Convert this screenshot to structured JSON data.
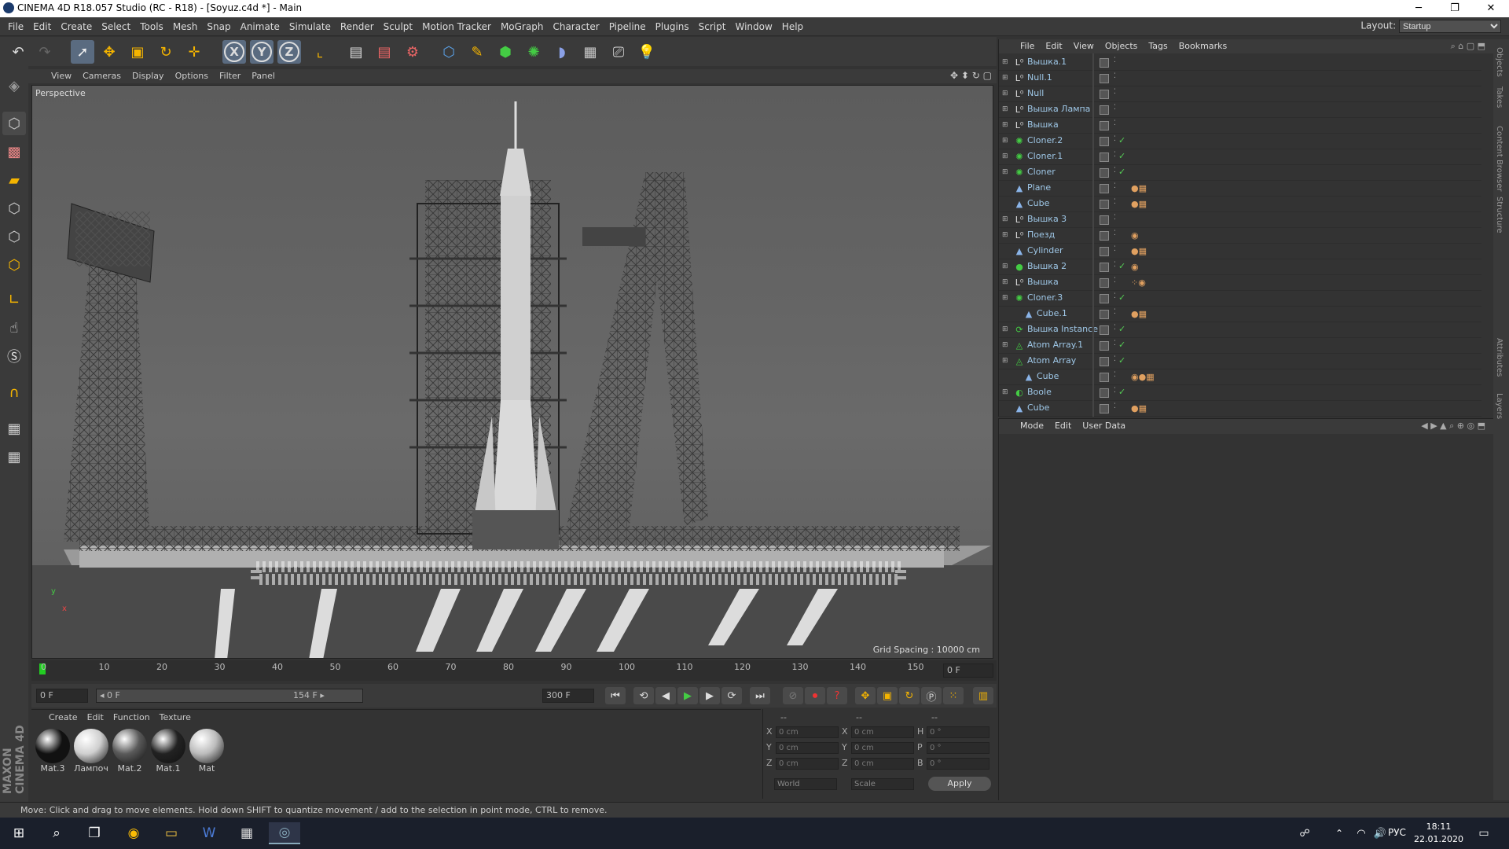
{
  "window": {
    "title": "CINEMA 4D R18.057 Studio (RC - R18) - [Soyuz.c4d *] - Main",
    "minimize": "─",
    "maximize": "❐",
    "close": "✕"
  },
  "menubar": {
    "items": [
      "File",
      "Edit",
      "Create",
      "Select",
      "Tools",
      "Mesh",
      "Snap",
      "Animate",
      "Simulate",
      "Render",
      "Sculpt",
      "Motion Tracker",
      "MoGraph",
      "Character",
      "Pipeline",
      "Plugins",
      "Script",
      "Window",
      "Help"
    ],
    "layout_label": "Layout:",
    "layout_value": "Startup"
  },
  "toolbar": {
    "axis_x": "X",
    "axis_y": "Y",
    "axis_z": "Z"
  },
  "viewport": {
    "menu": [
      "View",
      "Cameras",
      "Display",
      "Options",
      "Filter",
      "Panel"
    ],
    "label": "Perspective",
    "grid_spacing": "Grid Spacing : 10000 cm",
    "axis_y": "y",
    "axis_x": "x"
  },
  "timeline": {
    "ticks": [
      "0",
      "10",
      "20",
      "30",
      "40",
      "50",
      "60",
      "70",
      "80",
      "90",
      "100",
      "110",
      "120",
      "130",
      "140",
      "150"
    ],
    "current_frame": "0 F"
  },
  "transport": {
    "start": "0 F",
    "range_start": "◂ 0 F",
    "range_end": "154 F ▸",
    "end": "300 F"
  },
  "materials": {
    "menu": [
      "Create",
      "Edit",
      "Function",
      "Texture"
    ],
    "items": [
      {
        "name": "Mat.3",
        "color": "#111111"
      },
      {
        "name": "Лампоч",
        "color": "#cfcfcf"
      },
      {
        "name": "Mat.2",
        "color": "#5a5a5a"
      },
      {
        "name": "Mat.1",
        "color": "#222222"
      },
      {
        "name": "Mat",
        "color": "#bcbcbc"
      }
    ]
  },
  "coordinates": {
    "headers": [
      "--",
      "--",
      "--"
    ],
    "rows": [
      {
        "a": "X",
        "av": "0 cm",
        "b": "X",
        "bv": "0 cm",
        "c": "H",
        "cv": "0 °"
      },
      {
        "a": "Y",
        "av": "0 cm",
        "b": "Y",
        "bv": "0 cm",
        "c": "P",
        "cv": "0 °"
      },
      {
        "a": "Z",
        "av": "0 cm",
        "b": "Z",
        "bv": "0 cm",
        "c": "B",
        "cv": "0 °"
      }
    ],
    "world": "World",
    "scale": "Scale",
    "apply": "Apply"
  },
  "object_manager": {
    "menu": [
      "File",
      "Edit",
      "View",
      "Objects",
      "Tags",
      "Bookmarks"
    ],
    "objects": [
      {
        "name": "Вышка.1",
        "type": "null",
        "indent": 0,
        "check": "",
        "tags": ""
      },
      {
        "name": "Null.1",
        "type": "null",
        "indent": 0,
        "check": "",
        "tags": ""
      },
      {
        "name": "Null",
        "type": "null",
        "indent": 0,
        "check": "",
        "tags": ""
      },
      {
        "name": "Вышка Лампа",
        "type": "null",
        "indent": 0,
        "check": "",
        "tags": ""
      },
      {
        "name": "Вышка",
        "type": "null",
        "indent": 0,
        "check": "",
        "tags": ""
      },
      {
        "name": "Cloner.2",
        "type": "cloner",
        "indent": 0,
        "check": "✓",
        "tags": ""
      },
      {
        "name": "Cloner.1",
        "type": "cloner",
        "indent": 0,
        "check": "✓",
        "tags": ""
      },
      {
        "name": "Cloner",
        "type": "cloner",
        "indent": 0,
        "check": "✓",
        "tags": ""
      },
      {
        "name": "Plane",
        "type": "poly",
        "indent": 0,
        "check": "",
        "tags": "●▦"
      },
      {
        "name": "Cube",
        "type": "poly",
        "indent": 0,
        "check": "",
        "tags": "●▦"
      },
      {
        "name": "Вышка 3",
        "type": "null",
        "indent": 0,
        "check": "",
        "tags": ""
      },
      {
        "name": "Поезд",
        "type": "null",
        "indent": 0,
        "check": "",
        "tags": "◉"
      },
      {
        "name": "Cylinder",
        "type": "poly",
        "indent": 0,
        "check": "",
        "tags": "●▦"
      },
      {
        "name": "Вышка 2",
        "type": "sphere",
        "indent": 0,
        "check": "✓",
        "tags": "◉"
      },
      {
        "name": "Вышка",
        "type": "null",
        "indent": 0,
        "check": "",
        "tags": "⁘◉"
      },
      {
        "name": "Cloner.3",
        "type": "cloner",
        "indent": 0,
        "check": "✓",
        "tags": ""
      },
      {
        "name": "Cube.1",
        "type": "poly",
        "indent": 1,
        "check": "",
        "tags": "●▦"
      },
      {
        "name": "Вышка Instance",
        "type": "instance",
        "indent": 0,
        "check": "✓",
        "tags": ""
      },
      {
        "name": "Atom Array.1",
        "type": "atom",
        "indent": 0,
        "check": "✓",
        "tags": ""
      },
      {
        "name": "Atom Array",
        "type": "atom",
        "indent": 0,
        "check": "✓",
        "tags": ""
      },
      {
        "name": "Cube",
        "type": "poly",
        "indent": 1,
        "check": "",
        "tags": "◉●▦"
      },
      {
        "name": "Boole",
        "type": "boole",
        "indent": 0,
        "check": "✓",
        "tags": ""
      },
      {
        "name": "Cube",
        "type": "poly",
        "indent": 0,
        "check": "",
        "tags": "●▦"
      }
    ]
  },
  "attributes": {
    "menu": [
      "Mode",
      "Edit",
      "User Data"
    ]
  },
  "side_tabs": [
    "Objects",
    "Takes",
    "Content Browser",
    "Structure",
    "Attributes",
    "Layers"
  ],
  "status": "Move: Click and drag to move elements. Hold down SHIFT to quantize movement / add to the selection in point mode, CTRL to remove.",
  "brand": "MAXON CINEMA 4D",
  "taskbar": {
    "lang": "РУС",
    "time": "18:11",
    "date": "22.01.2020"
  }
}
